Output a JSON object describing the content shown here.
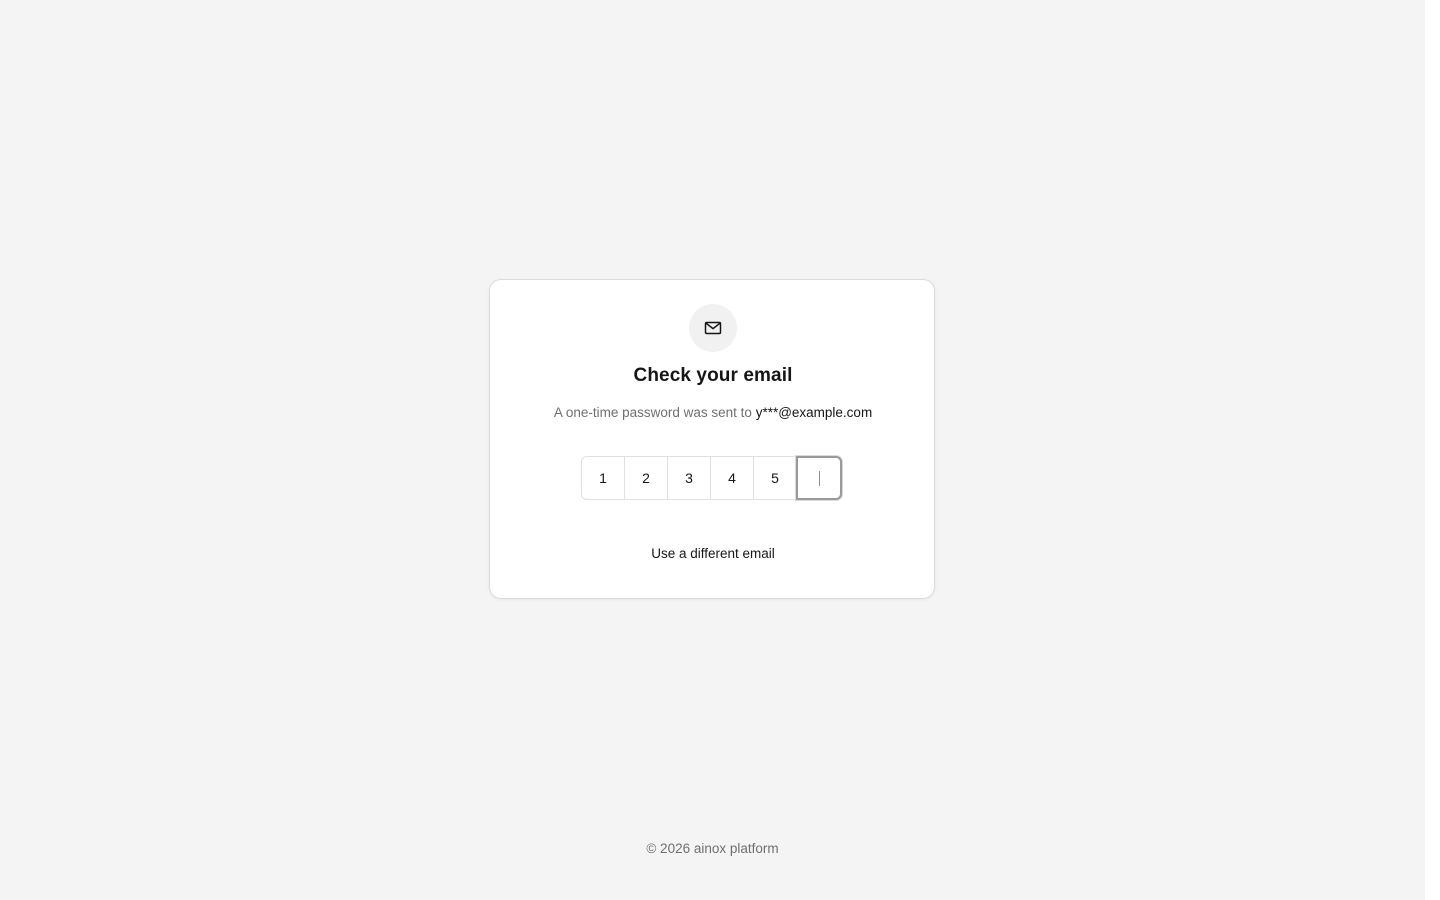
{
  "card": {
    "icon": "mail-icon",
    "title": "Check your email",
    "subtitle_prefix": "A one-time password was sent to",
    "email": "y***@example.com",
    "otp_digits": [
      "1",
      "2",
      "3",
      "4",
      "5",
      ""
    ],
    "active_index": 5,
    "alt_link": "Use a different email"
  },
  "footer": {
    "text": "© 2026 ainox platform"
  },
  "colors": {
    "background": "#f4f4f4",
    "card": "#ffffff",
    "text_primary": "#161616",
    "text_secondary": "#6f6f6f",
    "focus_border": "#9a9a9a"
  }
}
